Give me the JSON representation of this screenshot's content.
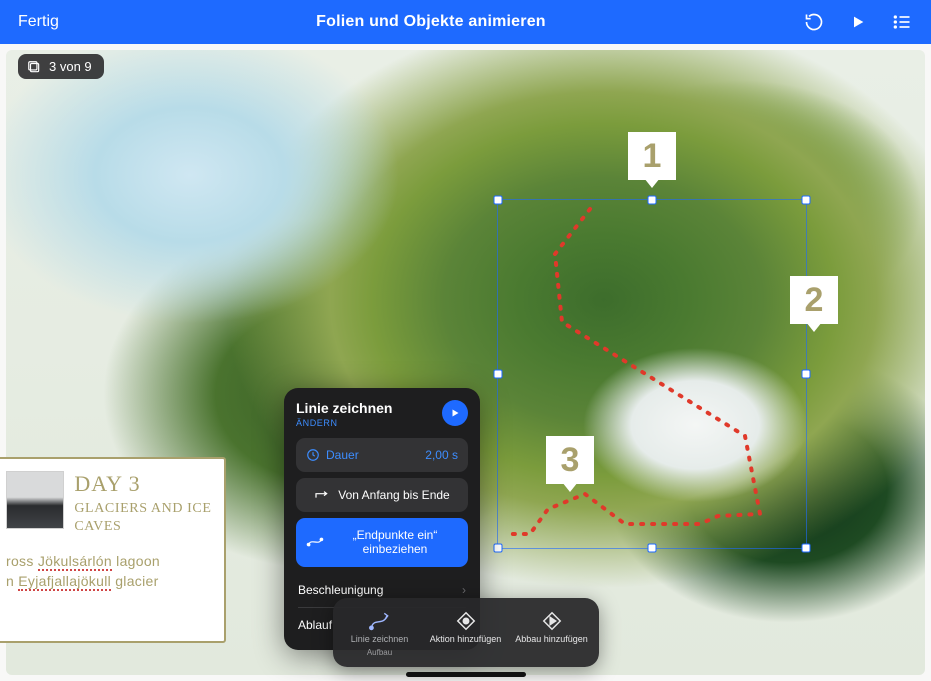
{
  "topbar": {
    "done": "Fertig",
    "title": "Folien und Objekte animieren"
  },
  "counter": {
    "text": "3 von 9"
  },
  "infocard": {
    "day": "DAY 3",
    "subtitle": "GLACIERS AND ICE CAVES",
    "line1_pre": "ross ",
    "line1_uw": "Jökulsárlón",
    "line1_post": " lagoon",
    "line2_pre": "n ",
    "line2_uw": "Eyjafjallajökull",
    "line2_post": " glacier"
  },
  "markers": {
    "one": "1",
    "two": "2",
    "three": "3"
  },
  "popover": {
    "title": "Linie zeichnen",
    "change": "ÄNDERN",
    "duration_label": "Dauer",
    "duration_value": "2,00 s",
    "direction": "Von Anfang bis Ende",
    "endpoints": "„Endpunkte ein“ einbeziehen",
    "accel": "Beschleunigung",
    "ablauf": "Ablauf"
  },
  "tools": {
    "drawline": "Linie zeichnen",
    "drawline_sub": "Aufbau",
    "addaction": "Aktion hinzufügen",
    "addbuildout": "Abbau hinzufügen"
  }
}
